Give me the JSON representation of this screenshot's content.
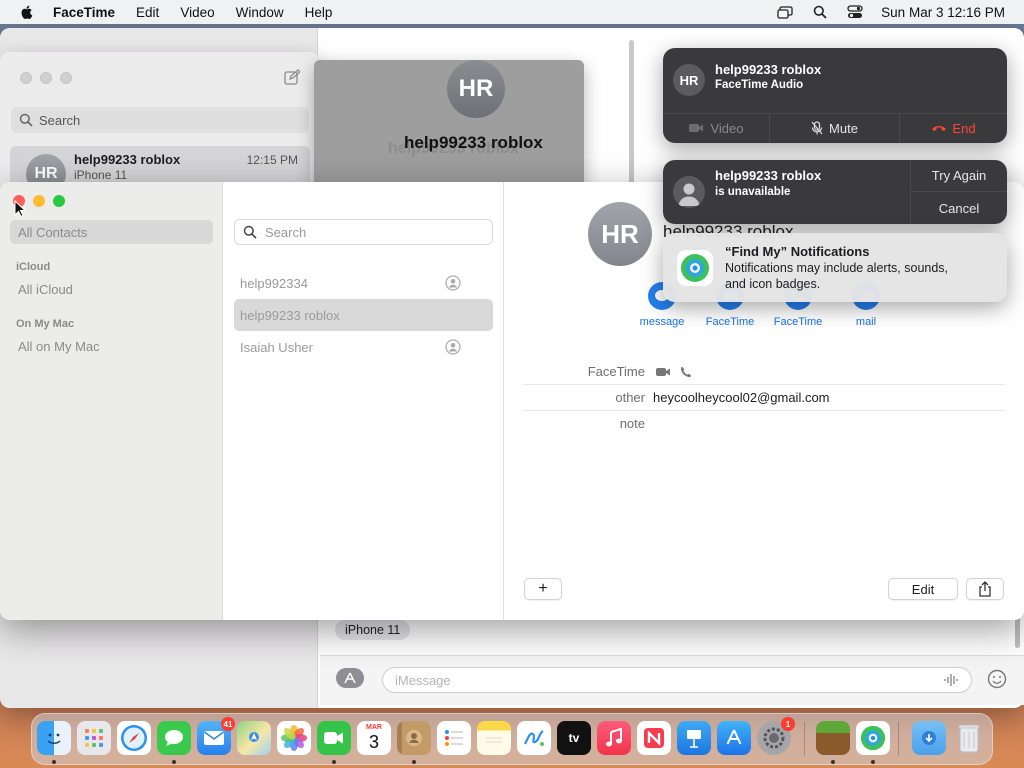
{
  "menubar": {
    "app": "FaceTime",
    "items": [
      "Edit",
      "Video",
      "Window",
      "Help"
    ],
    "clock": "Sun Mar 3  12:16 PM"
  },
  "messages_window": {
    "search_placeholder": "Search",
    "conversation": {
      "avatar": "HR",
      "name": "help99233 roblox",
      "time": "12:15 PM",
      "subtitle": "iPhone 11"
    },
    "bubble": "iPhone 11",
    "input_placeholder": "iMessage"
  },
  "call_card": {
    "avatar": "HR",
    "name": "help99233 roblox",
    "ghost_name": "help99233 roblox"
  },
  "contacts": {
    "sidebar": {
      "all_contacts": "All Contacts",
      "icloud_header": "iCloud",
      "all_icloud": "All iCloud",
      "mac_header": "On My Mac",
      "all_mac": "All on My Mac"
    },
    "search_placeholder": "Search",
    "list": [
      {
        "name": "help992334"
      },
      {
        "name": "help99233 roblox"
      },
      {
        "name": "Isaiah Usher"
      }
    ],
    "detail": {
      "avatar": "HR",
      "name": "help99233 roblox",
      "actions": [
        "message",
        "FaceTime",
        "FaceTime",
        "mail"
      ],
      "facetime_label": "FaceTime",
      "other_label": "other",
      "other_value": "heycoolheycool02@gmail.com",
      "note_label": "note",
      "add_button": "+",
      "edit_button": "Edit"
    }
  },
  "notifications": {
    "call": {
      "avatar": "HR",
      "title": "help99233 roblox",
      "subtitle": "FaceTime Audio",
      "video": "Video",
      "mute": "Mute",
      "end": "End"
    },
    "unavailable": {
      "title": "help99233 roblox",
      "subtitle": "is unavailable",
      "try_again": "Try Again",
      "cancel": "Cancel"
    },
    "findmy": {
      "title": "“Find My” Notifications",
      "body_1": "Notifications may include alerts, sounds,",
      "body_2": "and icon badges."
    }
  },
  "dock": {
    "calendar_month": "MAR",
    "calendar_day": "3",
    "mail_badge": "41",
    "settings_badge": "1",
    "tv_label": "tv"
  },
  "colors": {
    "accent": "#2580ef",
    "end_red": "#ff453a",
    "close_red": "#ff5f57",
    "minimize_yellow": "#febc2e",
    "zoom_green": "#28c840"
  }
}
